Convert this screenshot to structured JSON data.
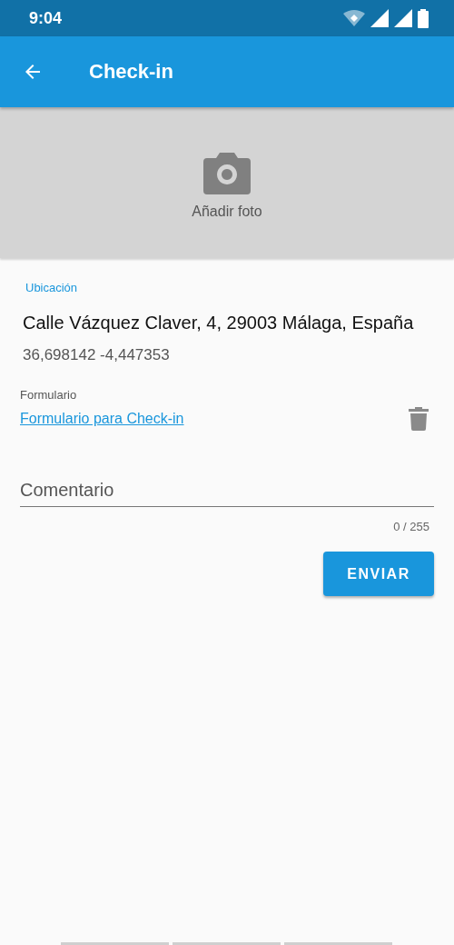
{
  "status_bar": {
    "time": "9:04"
  },
  "app_bar": {
    "title": "Check-in"
  },
  "photo": {
    "label": "Añadir foto"
  },
  "location": {
    "label": "Ubicación",
    "address": "Calle Vázquez Claver, 4, 29003 Málaga, España",
    "coordinates": "36,698142 -4,447353"
  },
  "form": {
    "label": "Formulario",
    "link": "Formulario para Check-in"
  },
  "comment": {
    "placeholder": "Comentario",
    "counter": "0 / 255"
  },
  "buttons": [
    "ENVIAR"
  ]
}
